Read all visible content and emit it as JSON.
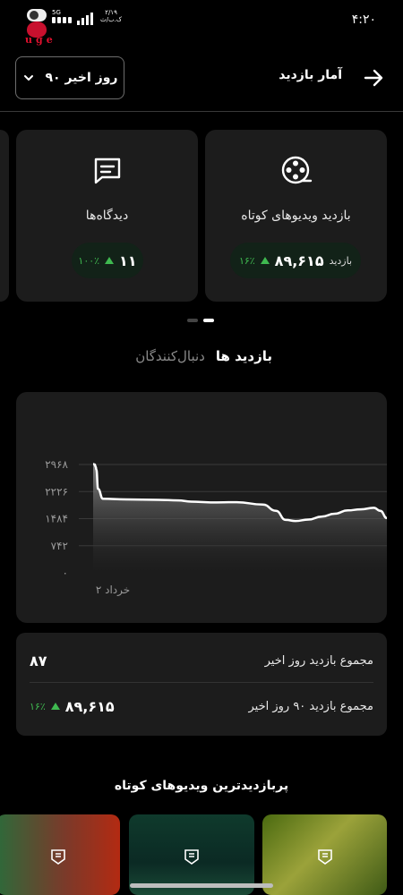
{
  "status_bar": {
    "time": "۴:۲۰",
    "network": "5G",
    "speed_value": "۲/۱۹",
    "speed_unit": "ک.ب/ث",
    "watermark_letters": "uge"
  },
  "header": {
    "title": "آمار بازدید",
    "range_label": "۹۰ روز اخیر"
  },
  "cards": [
    {
      "label": "بازدید ویدیوهای کوتاه",
      "value": "۸۹,۶۱۵",
      "unit": "بازدید",
      "change": "۱۶٪",
      "icon": "film-reel-icon"
    },
    {
      "label": "دیدگاه‌ها",
      "value": "۱۱",
      "change": "۱۰۰٪",
      "icon": "comment-icon"
    }
  ],
  "carousel": {
    "pages": 2,
    "active_index": 1
  },
  "tabs": [
    {
      "label": "بازدید ها",
      "active": true
    },
    {
      "label": "دنبال‌کنندگان",
      "active": false
    }
  ],
  "chart_data": {
    "type": "area",
    "title": "",
    "xlabel": "",
    "ylabel": "",
    "y_ticks": [
      "۰",
      "۷۴۲",
      "۱۴۸۴",
      "۲۲۲۶",
      "۲۹۶۸"
    ],
    "y_tick_values": [
      0,
      742,
      1484,
      2226,
      2968
    ],
    "ylim": [
      0,
      2968
    ],
    "x_tick_labels": [
      "۲ خرداد"
    ],
    "grid": true,
    "series": [
      {
        "x": [
          0,
          0.5,
          0.8,
          1,
          1.5,
          3,
          10,
          20,
          26,
          30,
          36,
          44,
          52,
          56,
          59,
          62,
          66,
          70,
          74,
          78,
          82,
          86,
          88,
          90
        ],
        "values": [
          2980,
          2968,
          2900,
          2820,
          2300,
          2030,
          2010,
          2000,
          1985,
          1950,
          1930,
          1935,
          1870,
          1700,
          1450,
          1420,
          1460,
          1540,
          1620,
          1710,
          1740,
          1780,
          1700,
          1500
        ]
      }
    ]
  },
  "summary": {
    "rows": [
      {
        "label": "مجموع بازدید روز اخیر",
        "value": "۸۷"
      },
      {
        "label": "مجموع بازدید ۹۰ روز اخیر",
        "value": "۸۹,۶۱۵",
        "change": "۱۶٪"
      }
    ]
  },
  "top_videos": {
    "title": "پربازدیدترین ویدیوهای کوتاه"
  }
}
